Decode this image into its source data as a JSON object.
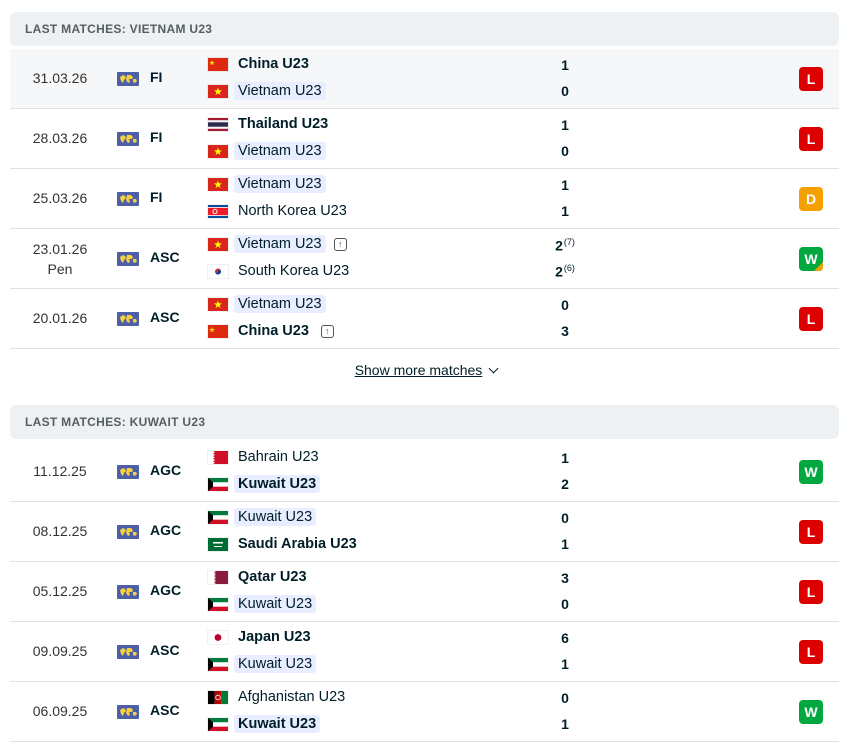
{
  "sections": [
    {
      "title": "LAST MATCHES: VIETNAM U23",
      "matches": [
        {
          "date": "31.03.26",
          "date2": "",
          "comp": "FI",
          "home": "China U23",
          "home_flag": "cn",
          "home_bold": true,
          "home_hl": false,
          "away": "Vietnam U23",
          "away_flag": "vn",
          "away_bold": false,
          "away_hl": true,
          "hs": "1",
          "as": "0",
          "hs_pen": "",
          "as_pen": "",
          "result": "L"
        },
        {
          "date": "28.03.26",
          "date2": "",
          "comp": "FI",
          "home": "Thailand U23",
          "home_flag": "th",
          "home_bold": true,
          "home_hl": false,
          "away": "Vietnam U23",
          "away_flag": "vn",
          "away_bold": false,
          "away_hl": true,
          "hs": "1",
          "as": "0",
          "hs_pen": "",
          "as_pen": "",
          "result": "L"
        },
        {
          "date": "25.03.26",
          "date2": "",
          "comp": "FI",
          "home": "Vietnam U23",
          "home_flag": "vn",
          "home_bold": false,
          "home_hl": true,
          "away": "North Korea U23",
          "away_flag": "kp",
          "away_bold": false,
          "away_hl": false,
          "hs": "1",
          "as": "1",
          "hs_pen": "",
          "as_pen": "",
          "result": "D"
        },
        {
          "date": "23.01.26",
          "date2": "Pen",
          "comp": "ASC",
          "home": "Vietnam U23",
          "home_flag": "vn",
          "home_bold": false,
          "home_hl": true,
          "home_promo": true,
          "away": "South Korea U23",
          "away_flag": "kr",
          "away_bold": false,
          "away_hl": false,
          "hs": "2",
          "as": "2",
          "hs_pen": "(7)",
          "as_pen": "(6)",
          "result": "W",
          "corner": true
        },
        {
          "date": "20.01.26",
          "date2": "",
          "comp": "ASC",
          "home": "Vietnam U23",
          "home_flag": "vn",
          "home_bold": false,
          "home_hl": true,
          "away": "China U23",
          "away_flag": "cn",
          "away_bold": true,
          "away_hl": false,
          "away_promo": true,
          "hs": "0",
          "as": "3",
          "hs_pen": "",
          "as_pen": "",
          "result": "L"
        }
      ]
    },
    {
      "title": "LAST MATCHES: KUWAIT U23",
      "matches": [
        {
          "date": "11.12.25",
          "date2": "",
          "comp": "AGC",
          "home": "Bahrain U23",
          "home_flag": "bh",
          "home_bold": false,
          "home_hl": false,
          "away": "Kuwait U23",
          "away_flag": "kw",
          "away_bold": true,
          "away_hl": true,
          "hs": "1",
          "as": "2",
          "hs_pen": "",
          "as_pen": "",
          "result": "W"
        },
        {
          "date": "08.12.25",
          "date2": "",
          "comp": "AGC",
          "home": "Kuwait U23",
          "home_flag": "kw",
          "home_bold": false,
          "home_hl": true,
          "away": "Saudi Arabia U23",
          "away_flag": "sa",
          "away_bold": true,
          "away_hl": false,
          "hs": "0",
          "as": "1",
          "hs_pen": "",
          "as_pen": "",
          "result": "L"
        },
        {
          "date": "05.12.25",
          "date2": "",
          "comp": "AGC",
          "home": "Qatar U23",
          "home_flag": "qa",
          "home_bold": true,
          "home_hl": false,
          "away": "Kuwait U23",
          "away_flag": "kw",
          "away_bold": false,
          "away_hl": true,
          "hs": "3",
          "as": "0",
          "hs_pen": "",
          "as_pen": "",
          "result": "L"
        },
        {
          "date": "09.09.25",
          "date2": "",
          "comp": "ASC",
          "home": "Japan U23",
          "home_flag": "jp",
          "home_bold": true,
          "home_hl": false,
          "away": "Kuwait U23",
          "away_flag": "kw",
          "away_bold": false,
          "away_hl": true,
          "hs": "6",
          "as": "1",
          "hs_pen": "",
          "as_pen": "",
          "result": "L"
        },
        {
          "date": "06.09.25",
          "date2": "",
          "comp": "ASC",
          "home": "Afghanistan U23",
          "home_flag": "af",
          "home_bold": false,
          "home_hl": false,
          "away": "Kuwait U23",
          "away_flag": "kw",
          "away_bold": true,
          "away_hl": true,
          "hs": "0",
          "as": "1",
          "hs_pen": "",
          "as_pen": "",
          "result": "W"
        }
      ]
    }
  ],
  "show_more": "Show more matches",
  "colors": {
    "loss": "#dc0000",
    "win": "#00a83f",
    "draw": "#f3a000"
  }
}
